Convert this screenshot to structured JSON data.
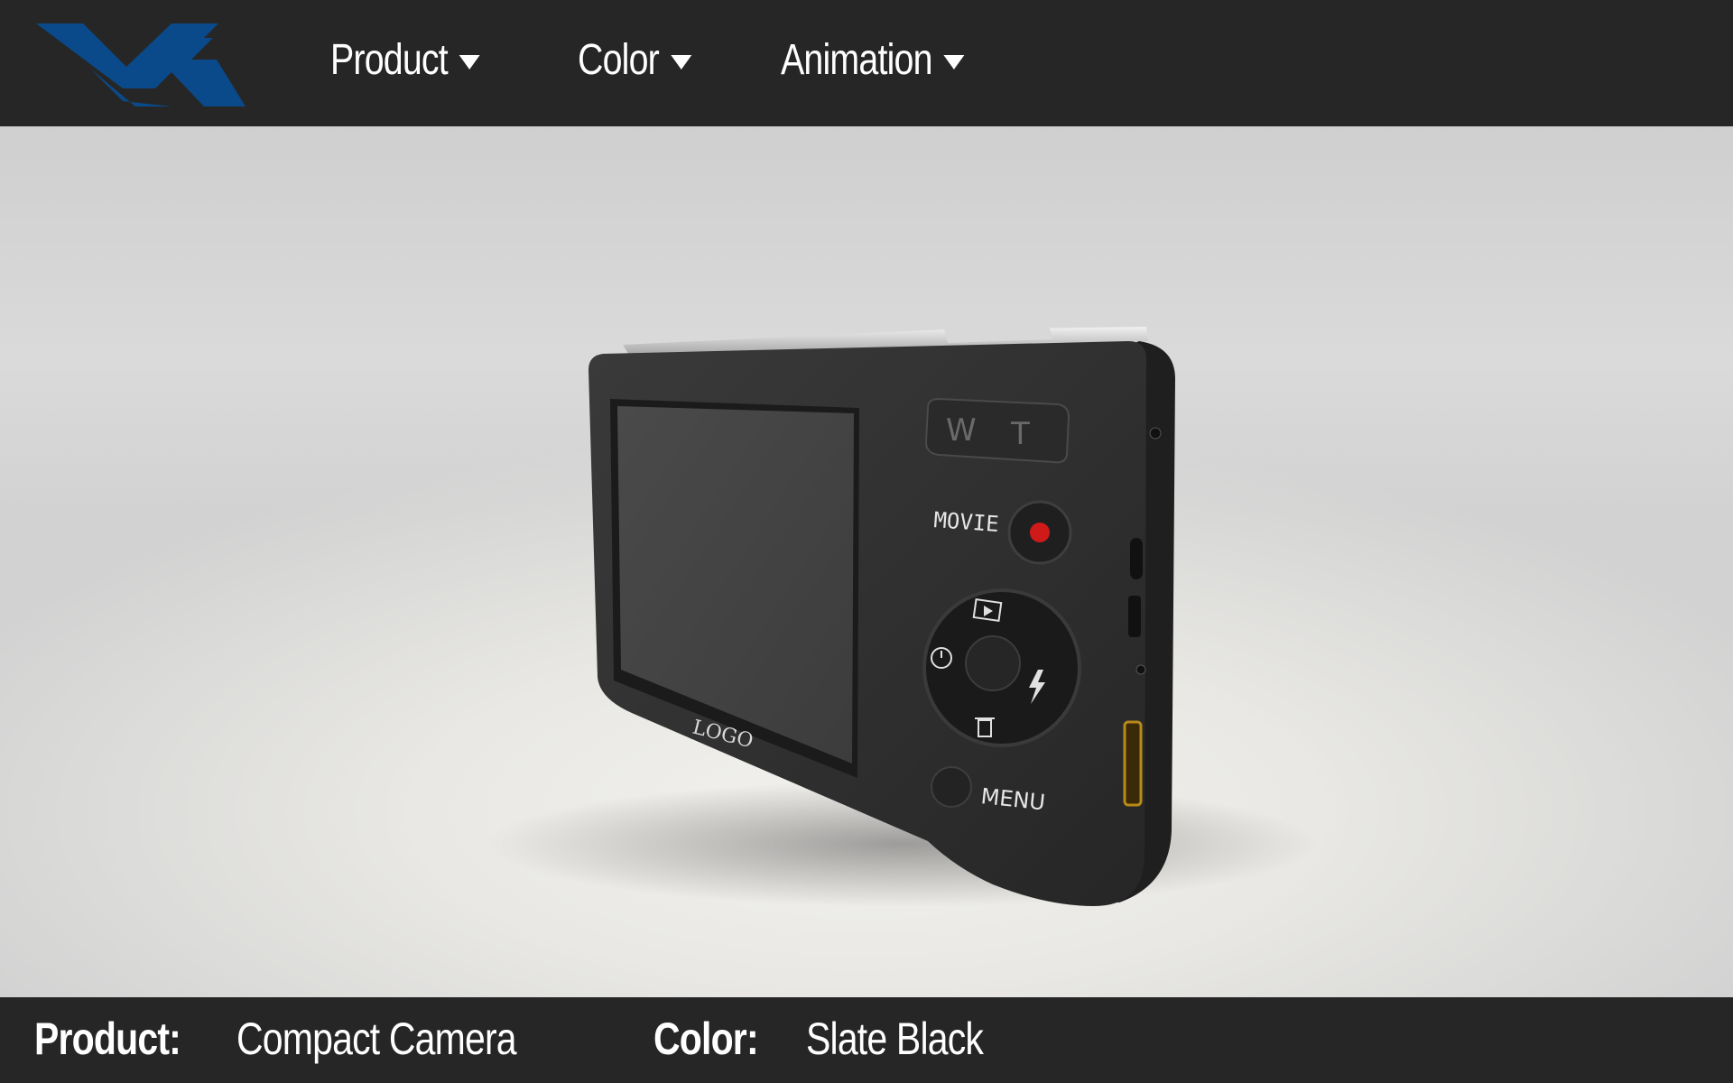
{
  "header": {
    "logo_icon": "brand-logo-icon",
    "brand_color": "#0a4a8a",
    "menu": [
      {
        "label": "Product",
        "icon": "chevron-down-icon"
      },
      {
        "label": "Color",
        "icon": "chevron-down-icon"
      },
      {
        "label": "Animation",
        "icon": "chevron-down-icon"
      }
    ]
  },
  "viewer": {
    "model": "compact-camera",
    "camera_labels": {
      "zoom_wide": "W",
      "zoom_tele": "T",
      "movie": "MOVIE",
      "menu": "MENU",
      "logo": "LOGO"
    },
    "record_button_color": "#d01a1a",
    "body_color": "#2f2f2f"
  },
  "footer": {
    "product_label": "Product:",
    "product_value": "Compact Camera",
    "color_label": "Color:",
    "color_value": "Slate Black"
  }
}
